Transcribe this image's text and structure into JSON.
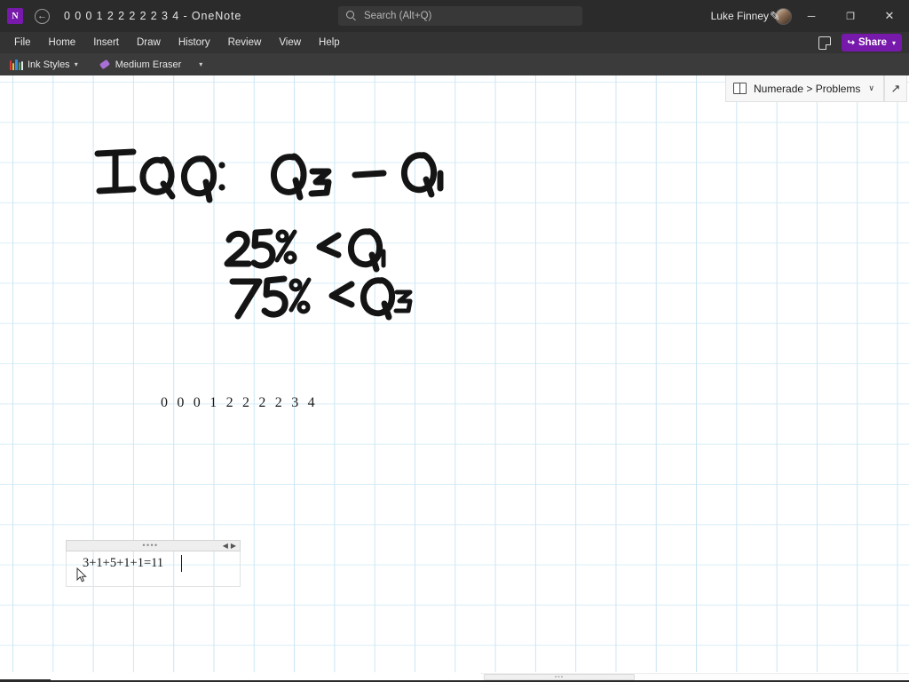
{
  "titlebar": {
    "app_logo": "onenote-logo",
    "logo_letter": "N",
    "back_arrow": "←",
    "document_title": "0 0 0 1 2 2 2 2 2 3 4  -  OneNote",
    "account_name": "Luke Finney",
    "pen_icon": "✎",
    "minimize": "─",
    "maximize": "❐",
    "close": "✕"
  },
  "search": {
    "placeholder": "Search (Alt+Q)",
    "icon": "search-icon"
  },
  "ribbon": {
    "tabs": [
      {
        "label": "File"
      },
      {
        "label": "Home"
      },
      {
        "label": "Insert"
      },
      {
        "label": "Draw"
      },
      {
        "label": "History"
      },
      {
        "label": "Review"
      },
      {
        "label": "View"
      },
      {
        "label": "Help"
      }
    ],
    "notes_icon": "sticky-note-icon",
    "share": {
      "label": "Share",
      "icon": "↪",
      "chevron": "▾",
      "color": "#7719aa"
    }
  },
  "drawbar": {
    "ink_styles": {
      "label": "Ink Styles",
      "chevron": "▾"
    },
    "eraser": {
      "label": "Medium Eraser"
    },
    "overflow_chevron": "▾",
    "pen_colors": [
      "#d93a3a",
      "#f0c030",
      "#3a8ad9",
      "#3aa55c",
      "#7719aa"
    ]
  },
  "page_header": {
    "notebook_icon": "notebook-icon",
    "breadcrumb": "Numerade > Problems",
    "chevron": "∨",
    "expand_icon": "↗"
  },
  "canvas": {
    "grid_color": "#cbe6f3",
    "background": "#ffffff",
    "ink_color": "#141414",
    "handwriting": [
      {
        "id": "iqr-formula",
        "text": "IQR:  Q₃ - Q₁"
      },
      {
        "id": "q1-line",
        "text": "25% ← Q₁"
      },
      {
        "id": "q3-line",
        "text": "75% ← Q₃"
      }
    ],
    "typed_digits": "0 0 0 1 2 2 2 2 3 4",
    "note_box": {
      "handle_dots": "••••",
      "arrow_left": "◀",
      "arrow_right": "▶",
      "text": "3+1+5+1+1=11"
    }
  },
  "scrollbar": {
    "grip": "•••"
  }
}
